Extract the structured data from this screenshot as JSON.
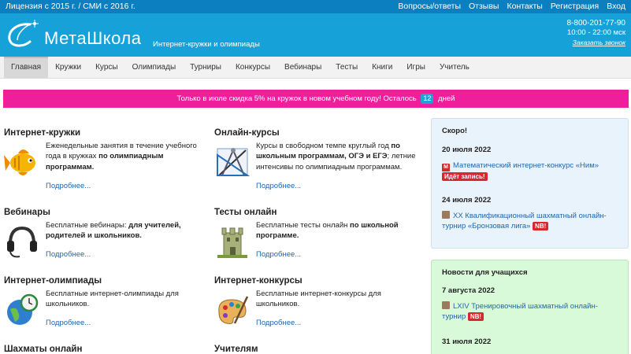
{
  "topbar": {
    "license": "Лицензия с 2015 г. / СМИ с 2016 г.",
    "links": [
      "Вопросы/ответы",
      "Отзывы",
      "Контакты",
      "Регистрация",
      "Вход"
    ]
  },
  "header": {
    "logo_text": "МетаШкола",
    "tagline": "Интернет-кружки и олимпиады",
    "phone": "8-800-201-77-90",
    "hours": "10:00 - 22:00 мск",
    "callback": "Заказать звонок"
  },
  "nav": {
    "tabs": [
      "Главная",
      "Кружки",
      "Курсы",
      "Олимпиады",
      "Турниры",
      "Конкурсы",
      "Вебинары",
      "Тесты",
      "Книги",
      "Игры",
      "Учитель"
    ],
    "active": 0
  },
  "promo": {
    "text_before": "Только в июле скидка 5% на кружок в новом учебном году! Осталось",
    "days": "12",
    "text_after": "дней"
  },
  "cards": [
    {
      "title": "Интернет-кружки",
      "desc_plain": "Еженедельные занятия в течение учебного года в кружках ",
      "desc_bold": "по олимпиадным программам.",
      "desc_tail": "",
      "more": "Подробнее...",
      "icon": "fish-icon"
    },
    {
      "title": "Онлайн-курсы",
      "desc_plain": "Курсы в свободном темпе круглый год ",
      "desc_bold": "по школьным программам, ОГЭ и ЕГЭ",
      "desc_tail": "; летние интенсивы по олимпиадным программам.",
      "more": "Подробнее...",
      "icon": "drafting-tools-icon"
    },
    {
      "title": "Вебинары",
      "desc_plain": "Бесплатные вебинары: ",
      "desc_bold": "для учителей, родителей и школьников.",
      "desc_tail": "",
      "more": "Подробнее...",
      "icon": "headset-icon"
    },
    {
      "title": "Тесты онлайн",
      "desc_plain": "Бесплатные тесты онлайн ",
      "desc_bold": "по школьной программе.",
      "desc_tail": "",
      "more": "Подробнее...",
      "icon": "castle-tower-icon"
    },
    {
      "title": "Интернет-олимпиады",
      "desc_plain": "Бесплатные интернет-олимпиады для школьников.",
      "desc_bold": "",
      "desc_tail": "",
      "more": "Подробнее...",
      "icon": "globe-clock-icon"
    },
    {
      "title": "Интернет-конкурсы",
      "desc_plain": "Бесплатные интернет-конкурсы для школьников.",
      "desc_bold": "",
      "desc_tail": "",
      "more": "Подробнее...",
      "icon": "paint-palette-icon"
    },
    {
      "title": "Шахматы онлайн",
      "desc_plain": "",
      "desc_bold": "",
      "desc_tail": "",
      "more": "",
      "icon": ""
    },
    {
      "title": "Учителям",
      "desc_plain": "",
      "desc_bold": "",
      "desc_tail": "",
      "more": "",
      "icon": ""
    }
  ],
  "soon": {
    "title": "Скоро!",
    "events": [
      {
        "date": "20 июля 2022",
        "name": "Математический интернет-конкурс «Ним»",
        "tag": "Идёт запись!"
      },
      {
        "date": "24 июля 2022",
        "name": "XX Квалификационный шахматный онлайн-турнир «Бронзовая лига»",
        "tag": "NB!"
      }
    ]
  },
  "news": {
    "title": "Новости для учащихся",
    "events": [
      {
        "date": "7 августа 2022",
        "name": "LXIV Тренировочный шахматный онлайн-турнир",
        "tag": "NB!"
      },
      {
        "date": "31 июля 2022",
        "name": "",
        "tag": ""
      }
    ]
  },
  "colors": {
    "topbar": "#0b7fc0",
    "header": "#16a2d8",
    "promo": "#ef1f9c",
    "link": "#2066b0",
    "soon_bg": "#e9f3fb",
    "news_bg": "#d8fad8",
    "tag_red": "#d9272e"
  }
}
